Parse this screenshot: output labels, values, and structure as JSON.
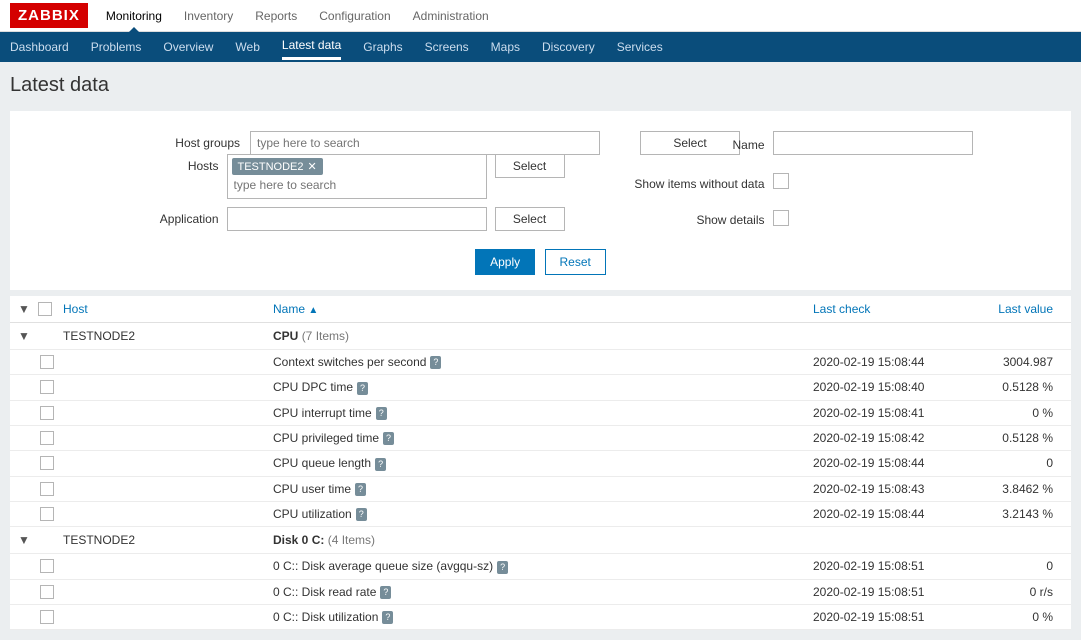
{
  "logo": "ZABBIX",
  "topnav": [
    "Monitoring",
    "Inventory",
    "Reports",
    "Configuration",
    "Administration"
  ],
  "topnav_active": 0,
  "subnav": [
    "Dashboard",
    "Problems",
    "Overview",
    "Web",
    "Latest data",
    "Graphs",
    "Screens",
    "Maps",
    "Discovery",
    "Services"
  ],
  "subnav_active": 4,
  "page_title": "Latest data",
  "filter": {
    "hostgroups_label": "Host groups",
    "hostgroups_placeholder": "type here to search",
    "hosts_label": "Hosts",
    "hosts_tag": "TESTNODE2",
    "hosts_placeholder": "type here to search",
    "application_label": "Application",
    "select_label": "Select",
    "name_label": "Name",
    "show_without_data_label": "Show items without data",
    "show_details_label": "Show details",
    "apply_label": "Apply",
    "reset_label": "Reset"
  },
  "columns": {
    "host": "Host",
    "name": "Name",
    "lastcheck": "Last check",
    "lastvalue": "Last value"
  },
  "groups": [
    {
      "host": "TESTNODE2",
      "name": "CPU",
      "count_text": "(7 Items)",
      "items": [
        {
          "name": "Context switches per second",
          "lastcheck": "2020-02-19 15:08:44",
          "lastvalue": "3004.987"
        },
        {
          "name": "CPU DPC time",
          "lastcheck": "2020-02-19 15:08:40",
          "lastvalue": "0.5128 %"
        },
        {
          "name": "CPU interrupt time",
          "lastcheck": "2020-02-19 15:08:41",
          "lastvalue": "0 %"
        },
        {
          "name": "CPU privileged time",
          "lastcheck": "2020-02-19 15:08:42",
          "lastvalue": "0.5128 %"
        },
        {
          "name": "CPU queue length",
          "lastcheck": "2020-02-19 15:08:44",
          "lastvalue": "0"
        },
        {
          "name": "CPU user time",
          "lastcheck": "2020-02-19 15:08:43",
          "lastvalue": "3.8462 %"
        },
        {
          "name": "CPU utilization",
          "lastcheck": "2020-02-19 15:08:44",
          "lastvalue": "3.2143 %"
        }
      ]
    },
    {
      "host": "TESTNODE2",
      "name": "Disk 0 C:",
      "count_text": "(4 Items)",
      "items": [
        {
          "name": "0 C:: Disk average queue size (avgqu-sz)",
          "lastcheck": "2020-02-19 15:08:51",
          "lastvalue": "0"
        },
        {
          "name": "0 C:: Disk read rate",
          "lastcheck": "2020-02-19 15:08:51",
          "lastvalue": "0 r/s"
        },
        {
          "name": "0 C:: Disk utilization",
          "lastcheck": "2020-02-19 15:08:51",
          "lastvalue": "0 %"
        }
      ]
    }
  ]
}
